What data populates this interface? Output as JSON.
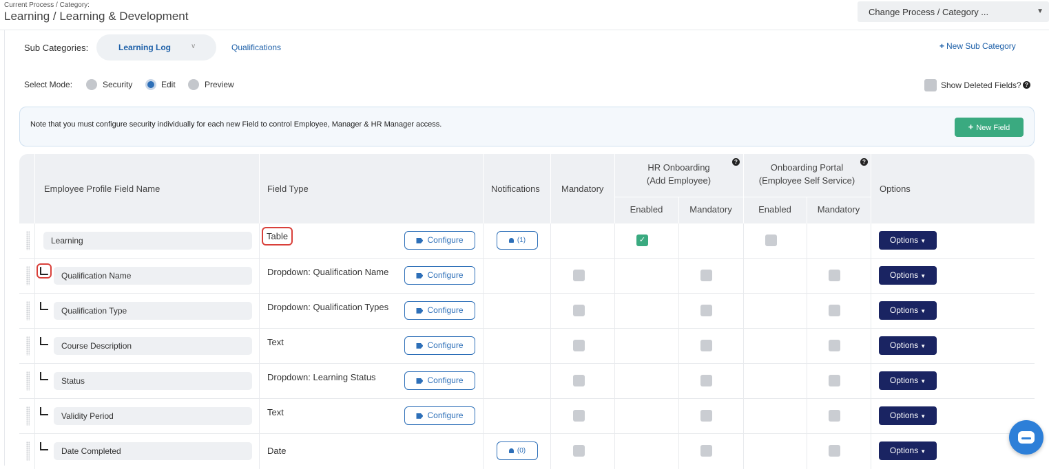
{
  "header": {
    "crumb_label": "Current Process / Category:",
    "crumb_value": "Learning / Learning & Development",
    "change_select": "Change Process / Category ..."
  },
  "subcategories": {
    "label": "Sub Categories:",
    "items": [
      "Learning Log",
      "Qualifications"
    ],
    "new_label": "New Sub Category"
  },
  "mode": {
    "label": "Select Mode:",
    "options": [
      "Security",
      "Edit",
      "Preview"
    ],
    "selected": "Edit",
    "show_deleted_label": "Show Deleted Fields?"
  },
  "note": {
    "text": "Note that you must configure security individually for each new Field to control Employee, Manager & HR Manager access.",
    "new_field_label": "New Field"
  },
  "table": {
    "headers": {
      "name": "Employee Profile Field Name",
      "type": "Field Type",
      "notifications": "Notifications",
      "mandatory": "Mandatory",
      "hr_onboarding": "HR Onboarding",
      "hr_onboarding_sub": "(Add Employee)",
      "portal": "Onboarding Portal",
      "portal_sub": "(Employee Self Service)",
      "enabled": "Enabled",
      "mandatory_sub": "Mandatory",
      "options": "Options"
    },
    "configure_label": "Configure",
    "options_label": "Options",
    "rows": [
      {
        "name": "Learning",
        "type": "Table",
        "notif": "(1)"
      },
      {
        "name": "Qualification Name",
        "type": "Dropdown: Qualification Name"
      },
      {
        "name": "Qualification Type",
        "type": "Dropdown: Qualification Types"
      },
      {
        "name": "Course Description",
        "type": "Text"
      },
      {
        "name": "Status",
        "type": "Dropdown: Learning Status"
      },
      {
        "name": "Validity Period",
        "type": "Text"
      },
      {
        "name": "Date Completed",
        "type": "Date",
        "notif": "(0)"
      }
    ]
  },
  "icons": {
    "help": "question-circle-icon",
    "plus": "plus-icon",
    "tag": "tag-icon",
    "bell": "bell-icon",
    "chat": "chat-bubble-icon"
  },
  "colors": {
    "accent": "#2d6fb8",
    "success": "#3aaa80",
    "options_bg": "#1a2462",
    "highlight": "#d9403a"
  }
}
